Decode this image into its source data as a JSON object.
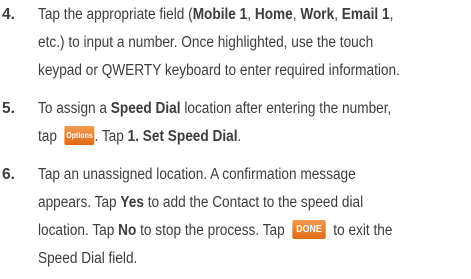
{
  "steps": [
    {
      "number": "4.",
      "lines": [
        {
          "pre": "Tap the appropriate field (",
          "b1": "Mobile 1",
          "s1": ", ",
          "b2": "Home",
          "s2": ", ",
          "b3": "Work",
          "s3": ", ",
          "b4": "Email 1",
          "post": ","
        },
        "etc.) to input a number. Once highlighted, use the touch",
        "keypad or QWERTY keyboard to enter required information."
      ]
    },
    {
      "number": "5.",
      "line1": {
        "pre": "To assign a ",
        "bold": "Speed Dial",
        "post": " location after entering the number,"
      },
      "line2": {
        "pre": "tap",
        "button": "Options",
        "mid": ". Tap ",
        "bold": "1. Set Speed Dial",
        "post": "."
      }
    },
    {
      "number": "6.",
      "line1": "Tap an unassigned location. A confirmation message",
      "line2": {
        "pre": "appears. Tap ",
        "bold": "Yes",
        "post": " to add the Contact to the speed dial"
      },
      "line3": {
        "pre": "location. Tap ",
        "bold": "No",
        "mid": " to stop the process. Tap",
        "button": "DONE",
        "post": "to exit the"
      },
      "line4": "Speed Dial field."
    }
  ],
  "colors": {
    "text": "#3d3d3d",
    "button_orange": "#e8741e"
  }
}
